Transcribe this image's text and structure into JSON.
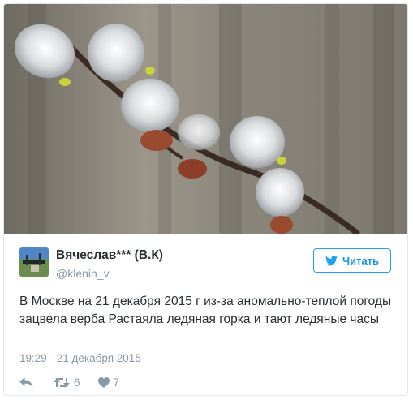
{
  "tweet": {
    "author_name": "Вячеслав*** (В.К)",
    "author_handle": "@klenin_v",
    "follow_label": "Читать",
    "text": "В Москве на 21 декабря 2015 г из-за аномально-теплой погоды зацвела верба Растаяла ледяная горка и тают ледяные часы",
    "timestamp": "19:29 - 21 декабря 2015",
    "retweets": "6",
    "likes": "7"
  },
  "icons": {
    "follow": "twitter-bird-icon",
    "reply": "reply-icon",
    "retweet": "retweet-icon",
    "like": "heart-icon"
  },
  "colors": {
    "accent": "#1da1f2",
    "text": "#292f33",
    "muted": "#8899a6",
    "border": "#e1e8ed"
  }
}
